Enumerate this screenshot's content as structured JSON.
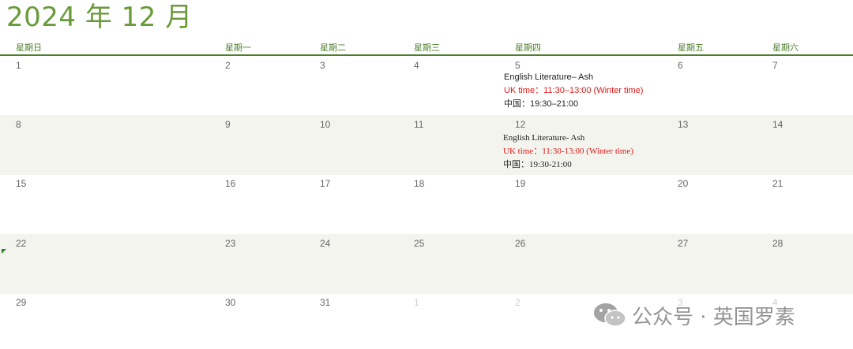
{
  "calendar": {
    "title": "2024 年 12 月",
    "weekdays": [
      "星期日",
      "星期一",
      "星期二",
      "星期三",
      "星期四",
      "星期五",
      "星期六"
    ],
    "weeks": [
      [
        "1",
        "2",
        "3",
        "4",
        "5",
        "6",
        "7"
      ],
      [
        "8",
        "9",
        "10",
        "11",
        "12",
        "13",
        "14"
      ],
      [
        "15",
        "16",
        "17",
        "18",
        "19",
        "20",
        "21"
      ],
      [
        "22",
        "23",
        "24",
        "25",
        "26",
        "27",
        "28"
      ],
      [
        "29",
        "30",
        "31",
        "1",
        "2",
        "3",
        "4"
      ]
    ],
    "events": [
      {
        "title": "English Literature– Ash",
        "uk_time": "UK time：11:30–13:00 (Winter time)",
        "china_time": "中国：19:30–21:00"
      },
      {
        "title": "English Literature- Ash",
        "uk_time": "UK time：11:30-13:00 (Winter time)",
        "china_time": "中国：19:30-21:00"
      }
    ]
  },
  "watermark": {
    "text": "公众号 · 英国罗素",
    "icon": "wechat-icon"
  },
  "colors": {
    "title": "#6a9a3a",
    "header": "#4f7f2d",
    "shaded_row": "#f3f4ee",
    "uk_time": "#e01a1a"
  }
}
